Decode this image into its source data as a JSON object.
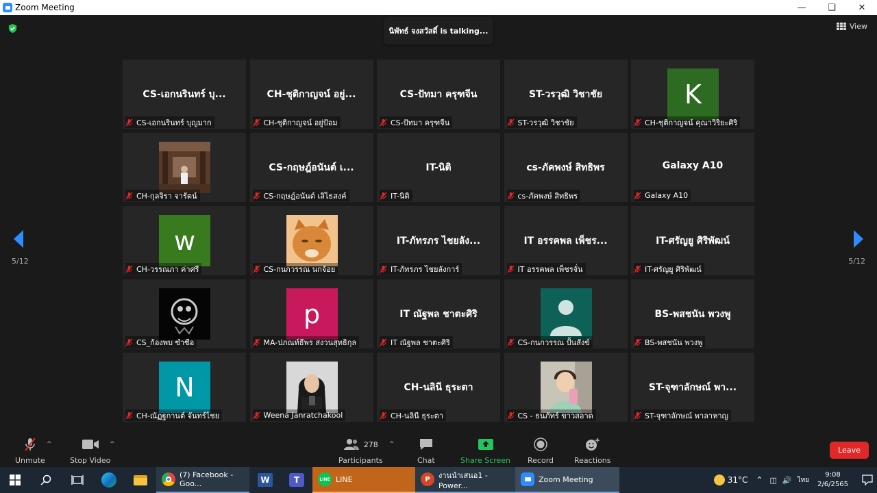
{
  "window": {
    "title": "Zoom Meeting"
  },
  "meeting": {
    "talking": "นิพัทธ์ จงสวัสดิ์ is  talking...",
    "view_label": "View",
    "page_left": "5/12",
    "page_right": "5/12"
  },
  "tiles": [
    {
      "center": "CS-เอกนรินทร์ บุ...",
      "label": "CS-เอกนรินทร์ บุญมาก"
    },
    {
      "center": "CH-ชุติกาญจน์ อยู่...",
      "label": "CH-ชุติกาญจน์ อยู่ป้อม"
    },
    {
      "center": "CS-ปัทมา ครุฑจีน",
      "label": "CS-ปัทมา ครุฑจีน"
    },
    {
      "center": "ST-วรวุฒิ วิชาชัย",
      "label": "ST-วรวุฒิ วิชาชัย"
    },
    {
      "avatar": "K",
      "avatar_color": "#2e6b22",
      "label": "CH-ชุติกาญจน์ คุณาวิริยะศิริ"
    },
    {
      "photo": "person-outdoor",
      "label": "CH-กุลจิรา จารัตน์"
    },
    {
      "center": "CS-กฤษฎ์อนันต์ เ...",
      "label": "CS-กฤษฎ์อนันต์ เลิไธสงค์"
    },
    {
      "center": "IT-นิติ",
      "label": "IT-นิติ"
    },
    {
      "center": "cs-ภัคพงษ์ สิทธิพร",
      "label": "cs-ภัคพงษ์ สิทธิพร"
    },
    {
      "center": "Galaxy A10",
      "label": "Galaxy A10"
    },
    {
      "avatar": "w",
      "avatar_color": "#3a7a1e",
      "label": "CH-วรรณภา ค่าศรี"
    },
    {
      "photo": "cat",
      "label": "CS-กนกวรรณ นกจ้อย"
    },
    {
      "center": "IT-ภัทรภร ไชยลัง...",
      "label": "IT-ภัทรภร ไชยลังการ์"
    },
    {
      "center": "IT อรรคพล เพ็ชร...",
      "label": "IT อรรคพล เพ็ชรจั่น"
    },
    {
      "center": "IT-ศรัญยู ศิริพัฒน์",
      "label": "IT-ศรัญยู ศิริพัฒน์"
    },
    {
      "photo": "dark-art",
      "label": "CS_ก้องพบ ซำซือ"
    },
    {
      "avatar": "p",
      "avatar_color": "#c8195d",
      "label": "MA-ปภณท์ธีพร สงวนสุทธิกุล"
    },
    {
      "center": "IT ณัฐพล ชาตะศิริ",
      "label": "IT ณัฐพล ชาตะศิริ"
    },
    {
      "photo": "silhouette",
      "label": "CS-กนกวรรณ ปั้นสังข์"
    },
    {
      "center": "BS-พสชนัน พวงพู",
      "label": "BS-พสชนัน พวงพู"
    },
    {
      "avatar": "N",
      "avatar_color": "#0097a7",
      "label": "CH-ณัฏฐกานต์ จันทร์ไชย"
    },
    {
      "photo": "woman",
      "label": "Weena Janratchakool"
    },
    {
      "center": "CH-นลินี ธุระตา",
      "label": "CH-นลินี ธุระตา"
    },
    {
      "photo": "man-drink",
      "label": "CS - ธนภัทร์ ขาวสอาด"
    },
    {
      "center": "ST-จุฑาลักษณ์ พา...",
      "label": "ST-จุฑาลักษณ์ พาลาหาญ"
    }
  ],
  "toolbar": {
    "unmute": "Unmute",
    "stop_video": "Stop Video",
    "participants": "Participants",
    "participants_count": "278",
    "chat": "Chat",
    "share": "Share Screen",
    "record": "Record",
    "reactions": "Reactions",
    "leave": "Leave"
  },
  "taskbar": {
    "chrome": "(7) Facebook - Goo...",
    "line": "LINE",
    "ppt": "งานนำเสนอ1 - Power...",
    "zoom": "Zoom Meeting",
    "temp": "31°C",
    "lang": "ไทย",
    "time": "9:08",
    "date": "2/6/2565"
  },
  "colors": {
    "accent": "#2d8cff",
    "leave": "#e02828",
    "share": "#22c55e"
  }
}
